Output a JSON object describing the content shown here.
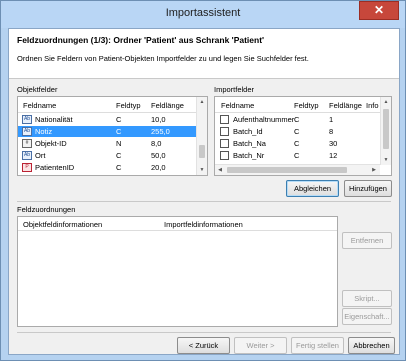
{
  "window": {
    "title": "Importassistent",
    "close_glyph": "✕"
  },
  "header": {
    "title": "Feldzuordnungen (1/3): Ordner 'Patient' aus Schrank 'Patient'",
    "description": "Ordnen Sie Feldern von Patient-Objekten Importfelder zu und legen Sie Suchfelder fest."
  },
  "objektfelder": {
    "label": "Objektfelder",
    "columns": [
      "Feldname",
      "Feldtyp",
      "Feldlänge"
    ],
    "rows": [
      {
        "icon": "text-field-icon",
        "glyph": "Ab",
        "name": "Nationalität",
        "type": "C",
        "length": "10,0",
        "selected": false
      },
      {
        "icon": "text-field-icon",
        "glyph": "Ab",
        "name": "Notiz",
        "type": "C",
        "length": "255,0",
        "selected": true
      },
      {
        "icon": "id-field-icon",
        "glyph": "#",
        "name": "Objekt-ID",
        "type": "N",
        "length": "8,0",
        "selected": false
      },
      {
        "icon": "text-field-icon",
        "glyph": "Ab",
        "name": "Ort",
        "type": "C",
        "length": "50,0",
        "selected": false
      },
      {
        "icon": "person-id-icon",
        "glyph": "P",
        "name": "PatientenID",
        "type": "C",
        "length": "20,0",
        "selected": false
      }
    ]
  },
  "importfelder": {
    "label": "Importfelder",
    "columns": [
      "Feldname",
      "Feldtyp",
      "Feldlänge",
      "Info"
    ],
    "rows": [
      {
        "name": "Aufenthaltnummer",
        "type": "C",
        "length": "1"
      },
      {
        "name": "Batch_Id",
        "type": "C",
        "length": "8"
      },
      {
        "name": "Batch_Na",
        "type": "C",
        "length": "30"
      },
      {
        "name": "Batch_Nr",
        "type": "C",
        "length": "12"
      }
    ]
  },
  "buttons": {
    "abgleichen": "Abgleichen",
    "hinzufuegen": "Hinzufügen",
    "entfernen": "Entfernen",
    "skript": "Skript...",
    "eigenschaften": "Eigenschaft...",
    "zurueck": "< Zurück",
    "weiter": "Weiter >",
    "fertig": "Fertig stellen",
    "abbrechen": "Abbrechen"
  },
  "feldzuordnungen": {
    "label": "Feldzuordnungen",
    "columns": [
      "Objektfeldinformationen",
      "Importfeldinformationen"
    ]
  }
}
